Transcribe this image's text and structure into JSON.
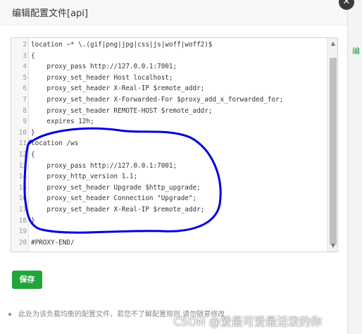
{
  "dialog": {
    "title": "编辑配置文件[api]",
    "close_symbol": "✕"
  },
  "backdrop": {
    "peek_text": "编"
  },
  "editor": {
    "lines": [
      {
        "n": "2",
        "text": "location ~* \\.(gif|png|jpg|css|js|woff|woff2)$"
      },
      {
        "n": "3",
        "text": "{"
      },
      {
        "n": "4",
        "text": "    proxy_pass http://127.0.0.1:7001;"
      },
      {
        "n": "5",
        "text": "    proxy_set_header Host localhost;"
      },
      {
        "n": "6",
        "text": "    proxy_set_header X-Real-IP $remote_addr;"
      },
      {
        "n": "7",
        "text": "    proxy_set_header X-Forwarded-For $proxy_add_x_forwarded_for;"
      },
      {
        "n": "8",
        "text": "    proxy_set_header REMOTE-HOST $remote_addr;"
      },
      {
        "n": "9",
        "text": "    expires 12h;"
      },
      {
        "n": "10",
        "text": "}"
      },
      {
        "n": "11",
        "text": "location /ws"
      },
      {
        "n": "12",
        "text": "{"
      },
      {
        "n": "13",
        "text": "    proxy_pass http://127.0.0.1:7001;"
      },
      {
        "n": "14",
        "text": "    proxy_http_version 1.1;"
      },
      {
        "n": "15",
        "text": "    proxy_set_header Upgrade $http_upgrade;"
      },
      {
        "n": "16",
        "text": "    proxy_set_header Connection \"Upgrade\";"
      },
      {
        "n": "17",
        "text": "    proxy_set_header X-Real-IP $remote_addr;"
      },
      {
        "n": "18",
        "text": "}"
      },
      {
        "n": "19",
        "text": ""
      },
      {
        "n": "20",
        "text": "#PROXY-END/"
      }
    ]
  },
  "actions": {
    "save_label": "保存"
  },
  "tip": {
    "text": "此处为该负载均衡的配置文件，若您不了解配置规则,请勿随意修改"
  },
  "watermark": {
    "text": "CSDN @爱最可爱最活泼的你"
  },
  "colors": {
    "accent": "#20a53a",
    "annotation": "#0000e0"
  }
}
